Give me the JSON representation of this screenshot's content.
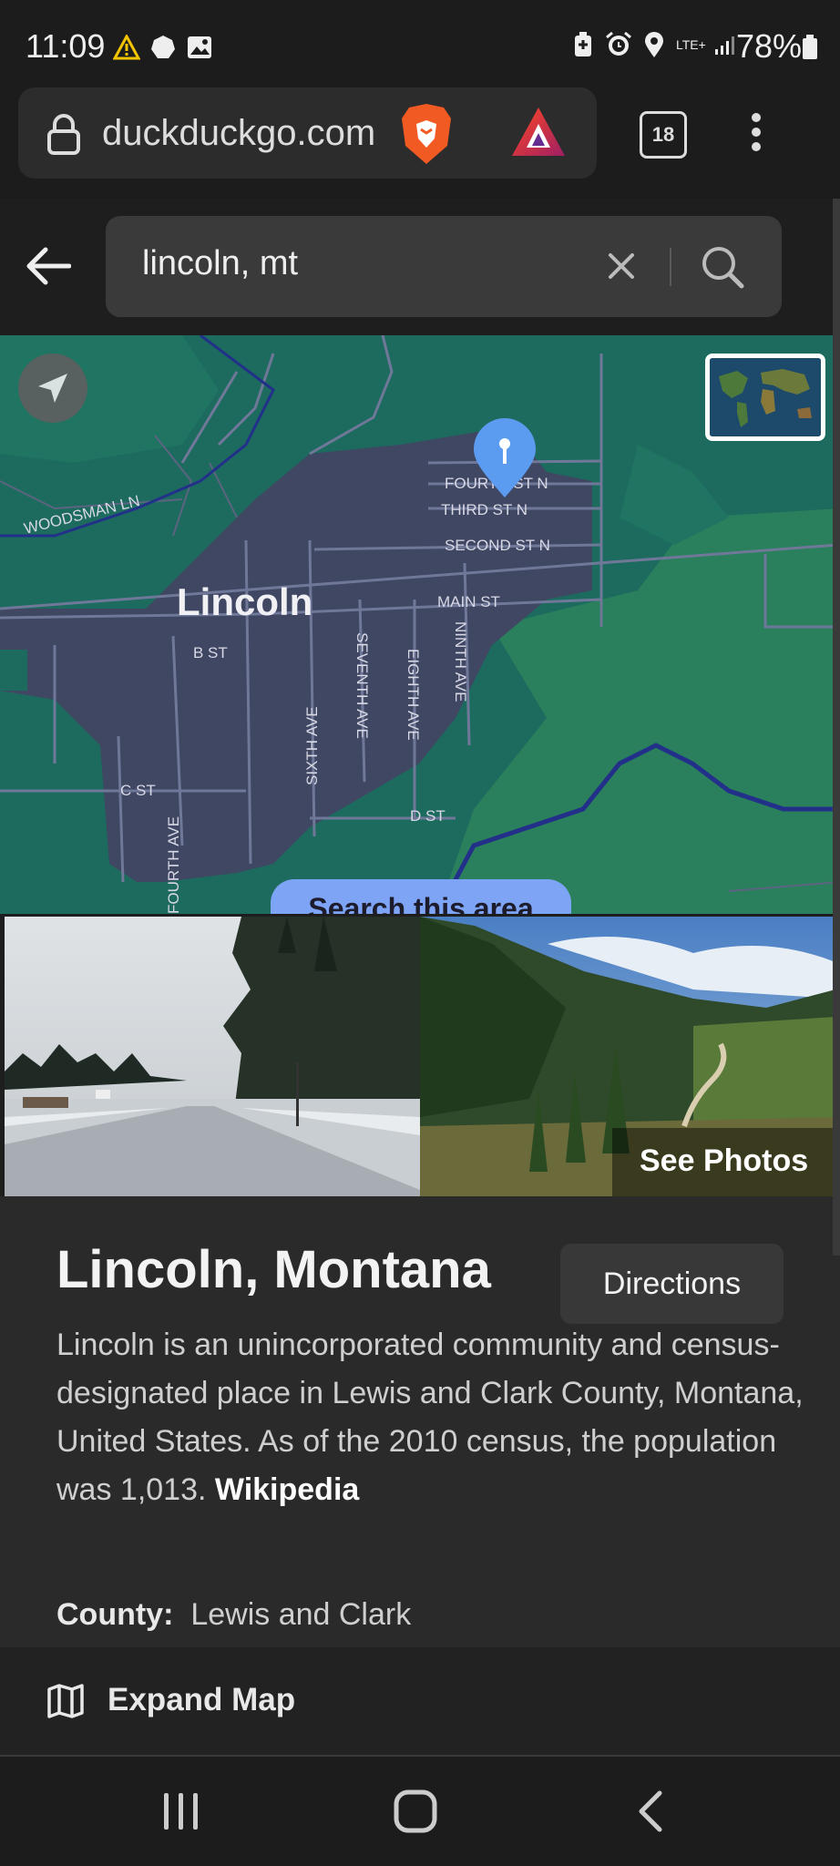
{
  "status_bar": {
    "time": "11:09",
    "battery": "78%",
    "network": "LTE+"
  },
  "browser": {
    "url": "duckduckgo.com",
    "tab_count": "18"
  },
  "search": {
    "query": "lincoln, mt"
  },
  "map": {
    "place_label": "Lincoln",
    "streets": [
      "WOODSMAN LN",
      "FOURTH ST N",
      "THIRD ST N",
      "SECOND ST N",
      "MAIN ST",
      "B ST",
      "SIXTH AVE",
      "SEVENTH AVE",
      "EIGHTH AVE",
      "NINTH AVE",
      "C ST",
      "D ST",
      "FOURTH AVE"
    ],
    "search_area_button": "Search this area"
  },
  "photos": {
    "see_photos_label": "See Photos"
  },
  "place": {
    "title": "Lincoln, Montana",
    "directions_label": "Directions",
    "description": "Lincoln is an unincorporated community and census-designated place in Lewis and Clark County, Montana, United States. As of the 2010 census, the population was 1,013.",
    "source": "Wikipedia",
    "county_label": "County:",
    "county_value": "Lewis and Clark"
  },
  "expand_map_label": "Expand Map",
  "colors": {
    "map_green": "#1c6b5e",
    "map_town": "#3f4763",
    "map_river": "#22308a",
    "pin_blue": "#5b9cf1"
  }
}
